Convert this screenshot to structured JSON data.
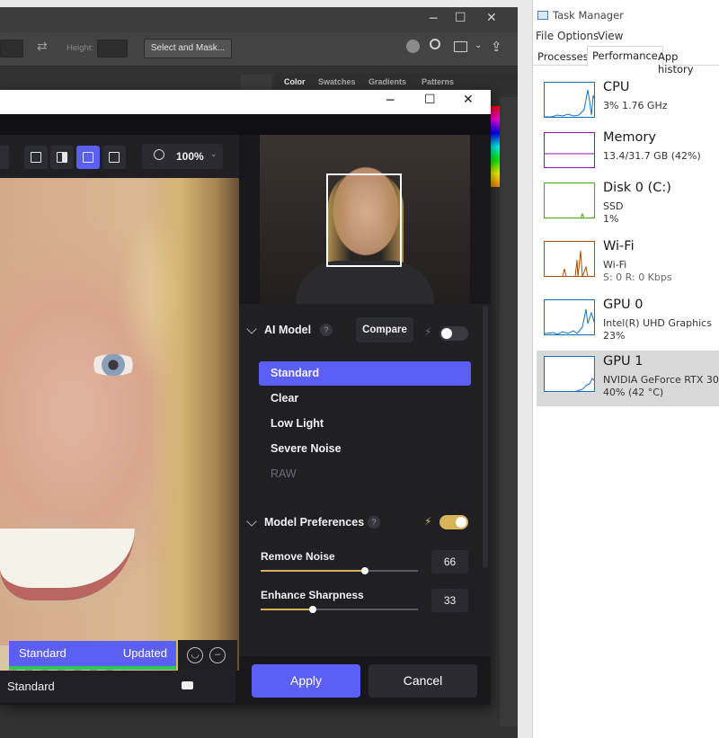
{
  "photoshop": {
    "height_label": "Height:",
    "select_mask_label": "Select and Mask...",
    "panel_tabs": [
      "Color",
      "Swatches",
      "Gradients",
      "Patterns"
    ],
    "window_buttons": {
      "minimize": "─",
      "maximize": "☐",
      "close": "✕"
    }
  },
  "dialog": {
    "window_buttons": {
      "minimize": "─",
      "maximize": "☐",
      "close": "✕"
    },
    "zoom": "100%",
    "compare_label": "Standard",
    "compare_status": "Updated",
    "bottom_label": "Standard",
    "sections": {
      "ai_model": {
        "title": "AI Model",
        "help": "?",
        "compare_button": "Compare",
        "toggle_on": false,
        "models": [
          {
            "label": "Standard",
            "selected": true,
            "enabled": true
          },
          {
            "label": "Clear",
            "selected": false,
            "enabled": true
          },
          {
            "label": "Low Light",
            "selected": false,
            "enabled": true
          },
          {
            "label": "Severe Noise",
            "selected": false,
            "enabled": true
          },
          {
            "label": "RAW",
            "selected": false,
            "enabled": false
          }
        ]
      },
      "model_preferences": {
        "title": "Model Preferences",
        "help": "?",
        "toggle_on": true,
        "sliders": [
          {
            "label": "Remove Noise",
            "value": "66",
            "fraction": 0.66
          },
          {
            "label": "Enhance Sharpness",
            "value": "33",
            "fraction": 0.33
          }
        ]
      }
    },
    "apply_label": "Apply",
    "cancel_label": "Cancel",
    "accent_color": "#5b5ff6",
    "toggle_color": "#d8b35a"
  },
  "task_manager": {
    "title": "Task Manager",
    "menu": [
      "File",
      "Options",
      "View"
    ],
    "tabs": [
      "Processes",
      "Performance",
      "App history"
    ],
    "active_tab": "Performance",
    "items": [
      {
        "name": "CPU",
        "lines": [
          "3%  1.76 GHz"
        ],
        "color": "#1172c4"
      },
      {
        "name": "Memory",
        "lines": [
          "13.4/31.7 GB (42%)"
        ],
        "color": "#8b12ae"
      },
      {
        "name": "Disk 0 (C:)",
        "lines": [
          "SSD",
          "1%"
        ],
        "color": "#4da60c"
      },
      {
        "name": "Wi-Fi",
        "lines": [
          "Wi-Fi",
          "S: 0  R: 0 Kbps"
        ],
        "color": "#a74f01"
      },
      {
        "name": "GPU 0",
        "lines": [
          "Intel(R) UHD Graphics",
          "23%"
        ],
        "color": "#1172c4"
      },
      {
        "name": "GPU 1",
        "lines": [
          "NVIDIA GeForce RTX 30",
          "40% (42 °C)"
        ],
        "color": "#1172c4",
        "selected": true
      }
    ]
  }
}
